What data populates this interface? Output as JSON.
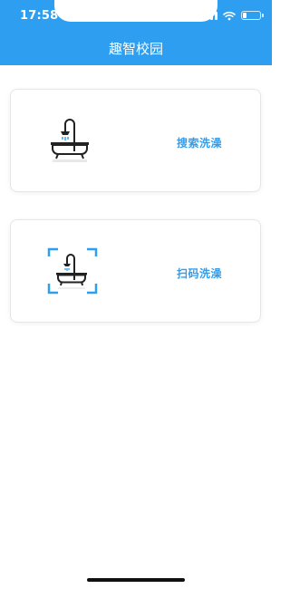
{
  "status_bar": {
    "time": "17:58"
  },
  "nav": {
    "title": "趣智校园"
  },
  "cards": [
    {
      "label": "搜索洗澡",
      "icon": "bathtub-shower-icon"
    },
    {
      "label": "扫码洗澡",
      "icon": "scan-bathtub-icon"
    }
  ],
  "colors": {
    "primary": "#2e9ef0",
    "icon_dark": "#222222",
    "background": "#ffffff"
  }
}
